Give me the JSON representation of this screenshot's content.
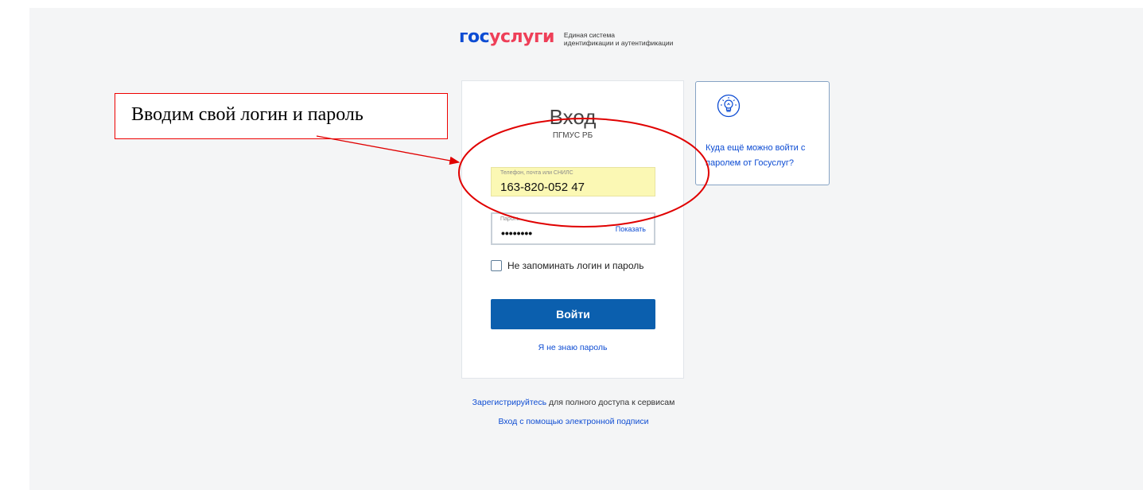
{
  "header": {
    "logo_part1": "гос",
    "logo_part2": "услуги",
    "logo_subtitle_line1": "Единая система",
    "logo_subtitle_line2": "идентификации и аутентификации"
  },
  "login_card": {
    "title": "Вход",
    "subtitle": "ПГМУС РБ",
    "login_field": {
      "label": "Телефон, почта или СНИЛС",
      "value": "163-820-052 47"
    },
    "password_field": {
      "label": "Пароль",
      "value": "••••••••",
      "show_label": "Показать"
    },
    "remember_label": "Не запоминать логин и пароль",
    "login_button": "Войти",
    "forgot_link": "Я не знаю пароль"
  },
  "hint_card": {
    "icon": "lightbulb-icon",
    "text": "Куда ещё можно войти с паролем от Госуслуг?"
  },
  "footer": {
    "register_link": "Зарегистрируйтесь",
    "register_rest": " для полного доступа к сервисам",
    "esign_link": "Вход с помощью электронной подписи"
  },
  "annotation": {
    "text": "Вводим свой логин и пароль"
  },
  "colors": {
    "brand_blue": "#0d4cd3",
    "brand_red": "#ee3f58",
    "button_blue": "#0b5fae",
    "autofill_yellow": "#fbf8b4",
    "annotation_red": "#e00000"
  }
}
